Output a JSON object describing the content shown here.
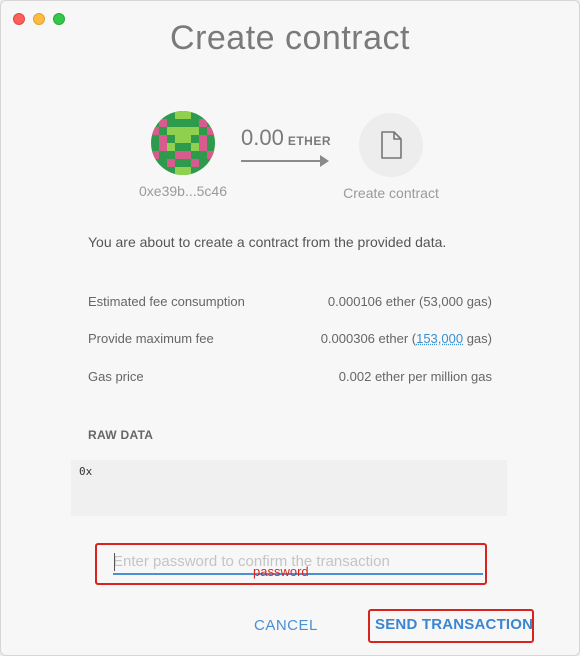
{
  "window": {
    "title": "Create contract",
    "controls": [
      "close",
      "minimize",
      "maximize"
    ]
  },
  "transfer": {
    "from_address": "0xe39b...5c46",
    "amount": "0.00",
    "unit": "ETHER",
    "to_label": "Create contract",
    "to_icon": "document-icon",
    "identicon_colors": [
      "#2e9b4c",
      "#d75c8e",
      "#8fd14f"
    ]
  },
  "description": "You are about to create a contract from the provided data.",
  "fees": {
    "estimated": {
      "label": "Estimated fee consumption",
      "value": "0.000106 ether (53,000 gas)"
    },
    "maximum": {
      "label": "Provide maximum fee",
      "value_prefix": "0.000306 ether (",
      "gas_link": "153,000",
      "value_suffix": " gas)"
    },
    "gas_price": {
      "label": "Gas price",
      "value": "0.002 ether per million gas"
    }
  },
  "raw_data": {
    "label": "RAW DATA",
    "value": "0x"
  },
  "password": {
    "placeholder": "Enter password to confirm the transaction",
    "annotation": "password"
  },
  "actions": {
    "cancel": "CANCEL",
    "send": "SEND TRANSACTION"
  },
  "colors": {
    "accent": "#4b8fd4",
    "highlight": "#d8231f"
  }
}
